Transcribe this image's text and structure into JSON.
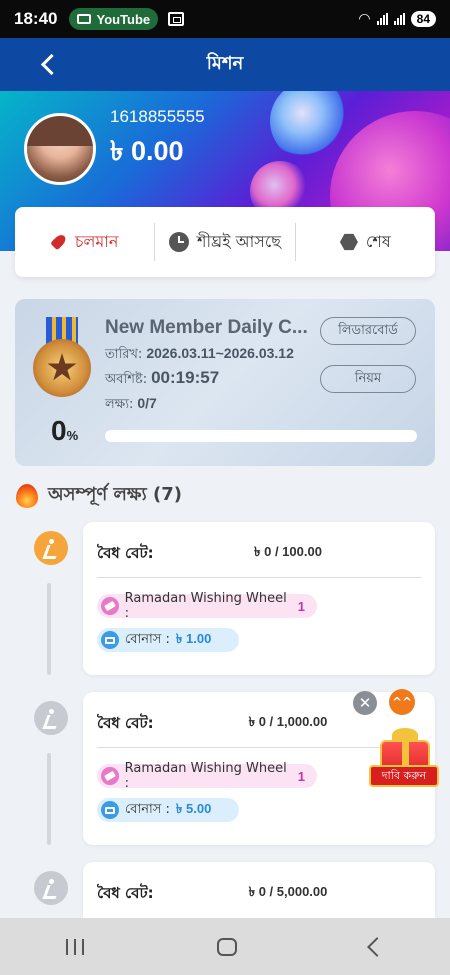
{
  "status": {
    "time": "18:40",
    "app_pill": "YouTube",
    "battery": "84"
  },
  "header": {
    "title": "মিশন"
  },
  "user": {
    "phone": "1618855555",
    "balance": "৳ 0.00"
  },
  "tabs": [
    {
      "label": "চলমান",
      "icon": "rocket-icon",
      "active": true
    },
    {
      "label": "শীঘ্রই আসছে",
      "icon": "clock-icon",
      "active": false
    },
    {
      "label": "শেষ",
      "icon": "hexagon-icon",
      "active": false
    }
  ],
  "mission": {
    "title": "New Member Daily C...",
    "date_label": "তারিখ:",
    "date_value": "2026.03.11~2026.03.12",
    "remaining_label": "অবশিষ্ট:",
    "remaining_value": "00:19:57",
    "target_label": "লক্ষ্য:",
    "target_value": "0/7",
    "percent": "0",
    "percent_unit": "%",
    "progress_fraction": 0,
    "leaderboard_btn": "লিডারবোর্ড",
    "rules_btn": "নিয়ম",
    "accent": "#ff9a3c"
  },
  "section": {
    "title": "অসম্পূর্ণ লক্ষ্য (7)"
  },
  "tasks": [
    {
      "label": "বৈধ বেট:",
      "progress": "৳ 0 / 100.00",
      "reward1_label": "Ramadan Wishing Wheel : ",
      "reward1_value": "1",
      "reward2_label": "বোনাস : ",
      "reward2_value": "৳ 1.00",
      "status": "active"
    },
    {
      "label": "বৈধ বেট:",
      "progress": "৳ 0 / 1,000.00",
      "reward1_label": "Ramadan Wishing Wheel : ",
      "reward1_value": "1",
      "reward2_label": "বোনাস : ",
      "reward2_value": "৳ 5.00",
      "status": "locked"
    },
    {
      "label": "বৈধ বেট:",
      "progress": "৳ 0 / 5,000.00",
      "status": "locked"
    }
  ],
  "floating": {
    "close": "✕",
    "up": "^^",
    "claim_label": "দাবি করুন"
  }
}
